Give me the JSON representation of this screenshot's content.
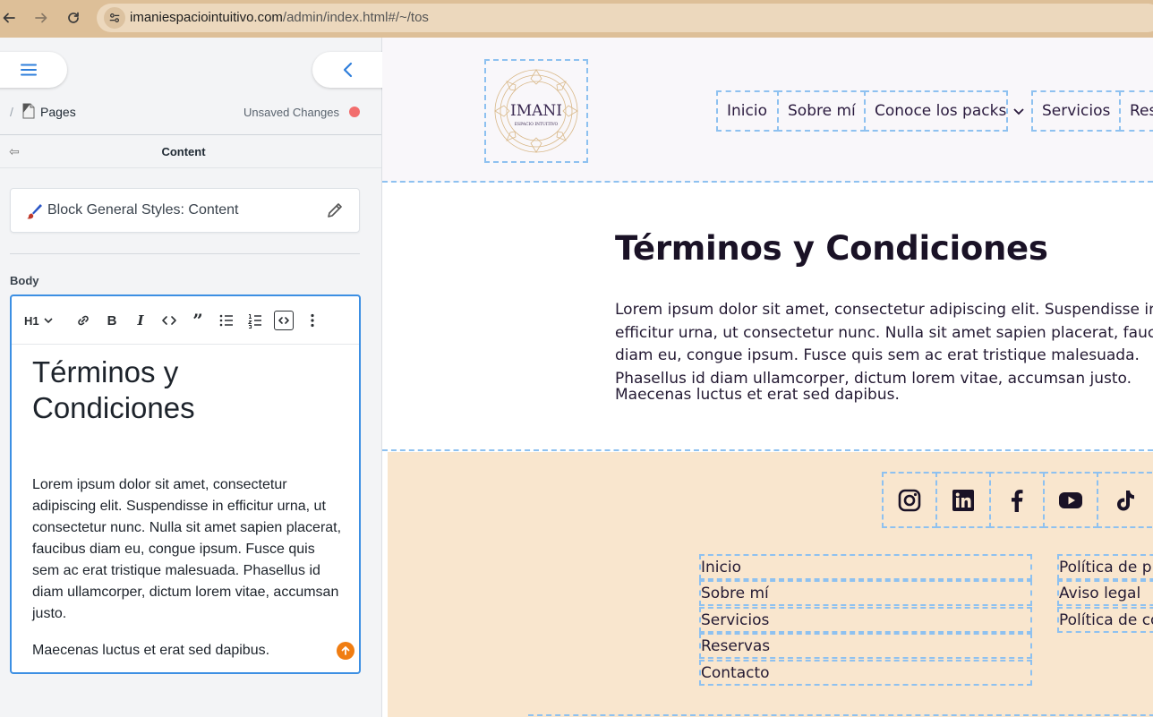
{
  "browser": {
    "url_host": "imaniespaciointuitivo.com",
    "url_path": "/admin/index.html#/~/tos"
  },
  "editor_panel": {
    "breadcrumb_sep": "/",
    "breadcrumb_label": "Pages",
    "unsaved_label": "Unsaved Changes",
    "content_title": "Content",
    "back_glyph": "⇦",
    "block_styles_label": "Block General Styles: Content",
    "body_label": "Body",
    "toolbar": {
      "heading_level": "H1",
      "items": [
        "link-icon",
        "bold-icon",
        "italic-icon",
        "code-icon",
        "quote-icon",
        "bulleted-list-icon",
        "numbered-list-icon",
        "code-block-icon",
        "more-icon"
      ]
    },
    "content": {
      "heading": "Términos y Condiciones",
      "paragraph1": "Lorem ipsum dolor sit amet, consectetur adipiscing elit. Suspendisse in efficitur urna, ut consectetur nunc. Nulla sit amet sapien placerat, faucibus diam eu, congue ipsum. Fusce quis sem ac erat tristique malesuada. Phasellus id diam ullamcorper, dictum lorem vitae, accumsan justo.",
      "paragraph2": "Maecenas luctus et erat sed dapibus."
    },
    "colors": {
      "accent": "#3c8fe3",
      "unsaved_dot": "#f26d6d",
      "badge": "#f07d12"
    }
  },
  "preview": {
    "logo": {
      "name": "IMANI",
      "tagline": "ESPACIO INTUITIVO"
    },
    "nav": [
      "Inicio",
      "Sobre mí",
      "Conoce los packs",
      "Servicios",
      "Reservas"
    ],
    "heading": "Términos y Condiciones",
    "paragraph1": "Lorem ipsum dolor sit amet, consectetur adipiscing elit. Suspendisse in efficitur urna, ut consectetur nunc. Nulla sit amet sapien placerat, faucibus diam eu, congue ipsum. Fusce quis sem ac erat tristique malesuada. Phasellus id diam ullamcorper, dictum lorem vitae, accumsan justo.",
    "paragraph2": "Maecenas luctus et erat sed dapibus.",
    "social": [
      "instagram-icon",
      "linkedin-icon",
      "facebook-icon",
      "youtube-icon",
      "tiktok-icon"
    ],
    "footer_links_col1": [
      "Inicio",
      "Sobre mí",
      "Servicios",
      "Reservas",
      "Contacto"
    ],
    "footer_links_col2": [
      "Política de privacidad",
      "Aviso legal",
      "Política de cookies"
    ],
    "colors": {
      "header_bg": "#f9f7fa",
      "footer_bg": "#f9e6ce",
      "text": "#241a33",
      "dashed": "#8ec1f0"
    }
  }
}
